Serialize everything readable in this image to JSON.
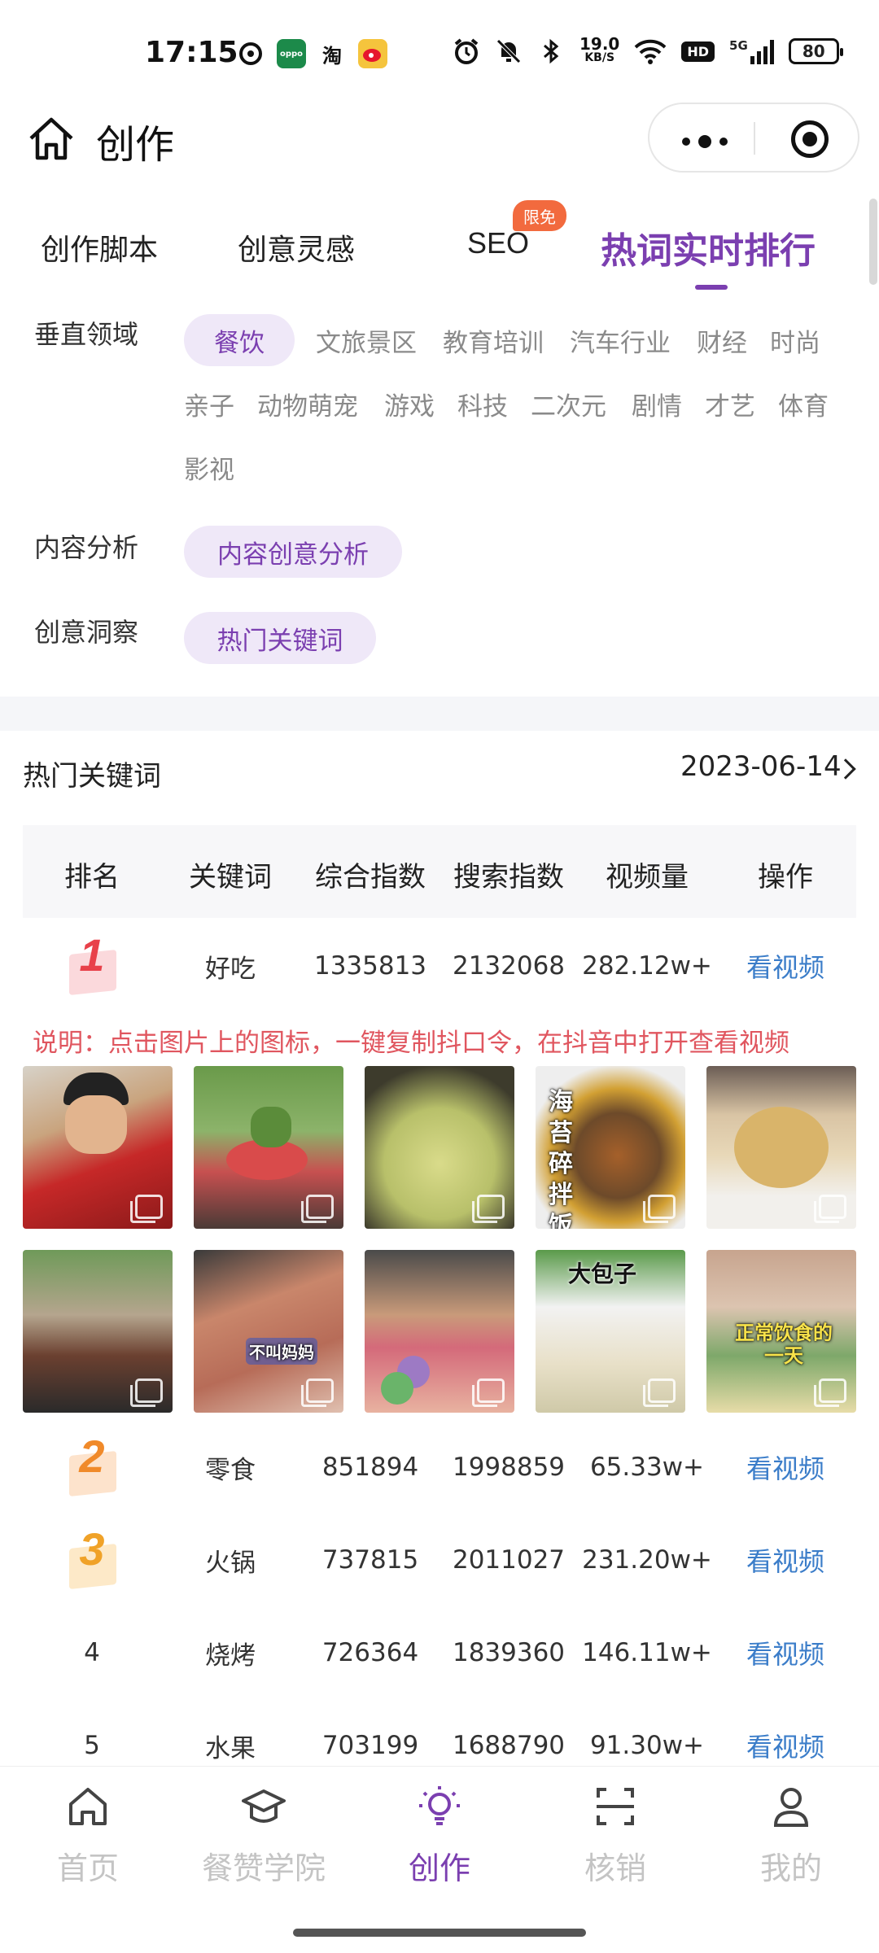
{
  "status_bar": {
    "time": "17:15",
    "apps": [
      "淘"
    ],
    "net_speed_value": "19.0",
    "net_speed_unit": "KB/S",
    "hd": "HD",
    "signal": "5G",
    "battery": "80",
    "icons": [
      "app-icon-1",
      "oppo-icon",
      "taobao-icon",
      "weibo-icon",
      "alarm-icon",
      "mute-icon",
      "bluetooth-icon",
      "wifi-icon",
      "signal-icon",
      "battery-icon"
    ]
  },
  "header": {
    "title": "创作",
    "icons": [
      "home-icon",
      "more-icon",
      "target-icon"
    ]
  },
  "tabs": [
    {
      "label": "创作脚本"
    },
    {
      "label": "创意灵感"
    },
    {
      "label": "SEO",
      "badge": "限免"
    },
    {
      "label": "热词实时排行",
      "active": true
    }
  ],
  "filters": {
    "vertical": {
      "label": "垂直领域",
      "selected": "餐饮",
      "options": [
        "文旅景区",
        "教育培训",
        "汽车行业",
        "财经",
        "时尚",
        "亲子",
        "动物萌宠",
        "游戏",
        "科技",
        "二次元",
        "剧情",
        "才艺",
        "体育",
        "影视"
      ]
    },
    "content": {
      "label": "内容分析",
      "selected": "内容创意分析"
    },
    "insight": {
      "label": "创意洞察",
      "selected": "热门关键词"
    }
  },
  "ranking": {
    "title": "热门关键词",
    "date": "2023-06-14",
    "columns": [
      "排名",
      "关键词",
      "综合指数",
      "搜索指数",
      "视频量",
      "操作"
    ],
    "rows": [
      {
        "rank": "1",
        "keyword": "好吃",
        "composite": "1335813",
        "search": "2132068",
        "videos": "282.12w+",
        "action": "看视频"
      },
      {
        "rank": "2",
        "keyword": "零食",
        "composite": "851894",
        "search": "1998859",
        "videos": "65.33w+",
        "action": "看视频"
      },
      {
        "rank": "3",
        "keyword": "火锅",
        "composite": "737815",
        "search": "2011027",
        "videos": "231.20w+",
        "action": "看视频"
      },
      {
        "rank": "4",
        "keyword": "烧烤",
        "composite": "726364",
        "search": "1839360",
        "videos": "146.11w+",
        "action": "看视频"
      },
      {
        "rank": "5",
        "keyword": "水果",
        "composite": "703199",
        "search": "1688790",
        "videos": "91.30w+",
        "action": "看视频"
      }
    ],
    "note": "说明：点击图片上的图标，一键复制抖口令，在抖音中打开查看视频",
    "thumb_captions": {
      "t4": "海苔碎拌饭",
      "t7": "不叫妈妈",
      "t9": "大包子",
      "t10": "正常饮食的一天"
    }
  },
  "bottom_nav": [
    {
      "label": "首页",
      "icon": "home-outline-icon"
    },
    {
      "label": "餐赞学院",
      "icon": "graduation-cap-icon"
    },
    {
      "label": "创作",
      "icon": "lightbulb-icon",
      "active": true
    },
    {
      "label": "核销",
      "icon": "scan-icon"
    },
    {
      "label": "我的",
      "icon": "user-icon"
    }
  ],
  "colors": {
    "accent": "#7b3fb0",
    "chip_bg": "#efe8f8",
    "link": "#3b7dc9",
    "note": "#e0565f",
    "badge": "#f26a3e",
    "rank1": "#e8414a",
    "rank23": "#f08a2a"
  }
}
